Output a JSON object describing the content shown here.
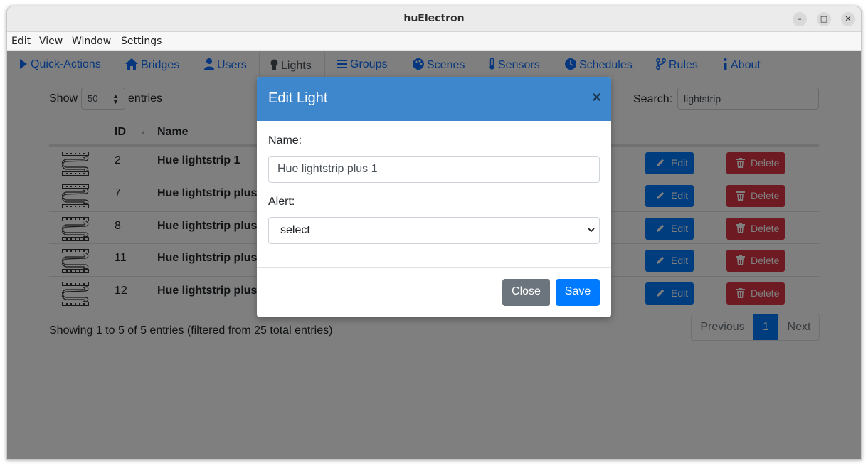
{
  "window": {
    "title": "huElectron",
    "controls": {
      "minimize": "–",
      "maximize": "□",
      "close": "✕"
    }
  },
  "menu": [
    "Edit",
    "View",
    "Window",
    "Settings"
  ],
  "tabs": [
    {
      "label": "Quick-Actions",
      "icon": "play-icon"
    },
    {
      "label": "Bridges",
      "icon": "home-icon"
    },
    {
      "label": "Users",
      "icon": "user-icon"
    },
    {
      "label": "Lights",
      "icon": "lightbulb-icon",
      "active": true
    },
    {
      "label": "Groups",
      "icon": "list-icon"
    },
    {
      "label": "Scenes",
      "icon": "palette-icon"
    },
    {
      "label": "Sensors",
      "icon": "thermometer-icon"
    },
    {
      "label": "Schedules",
      "icon": "clock-icon"
    },
    {
      "label": "Rules",
      "icon": "branch-icon"
    },
    {
      "label": "About",
      "icon": "info-icon"
    }
  ],
  "table_controls": {
    "show_label": "Show",
    "entries_value": "50",
    "entries_label": "entries",
    "search_label": "Search:",
    "search_value": "lightstrip"
  },
  "table": {
    "columns": [
      "ID",
      "Name"
    ],
    "rows": [
      {
        "id": "2",
        "name": "Hue lightstrip 1"
      },
      {
        "id": "7",
        "name": "Hue lightstrip plus"
      },
      {
        "id": "8",
        "name": "Hue lightstrip plus"
      },
      {
        "id": "11",
        "name": "Hue lightstrip plus"
      },
      {
        "id": "12",
        "name": "Hue lightstrip plus"
      }
    ],
    "edit_label": "Edit",
    "delete_label": "Delete"
  },
  "footer": {
    "info": "Showing 1 to 5 of 5 entries (filtered from 25 total entries)",
    "previous": "Previous",
    "page": "1",
    "next": "Next"
  },
  "modal": {
    "title": "Edit Light",
    "close_glyph": "×",
    "name_label": "Name:",
    "name_value": "Hue lightstrip plus 1",
    "alert_label": "Alert:",
    "alert_value": "select",
    "close_button": "Close",
    "save_button": "Save"
  },
  "colors": {
    "primary": "#007bff",
    "danger": "#dc3545",
    "modal_header": "#3f87cc",
    "secondary": "#6c757d"
  }
}
